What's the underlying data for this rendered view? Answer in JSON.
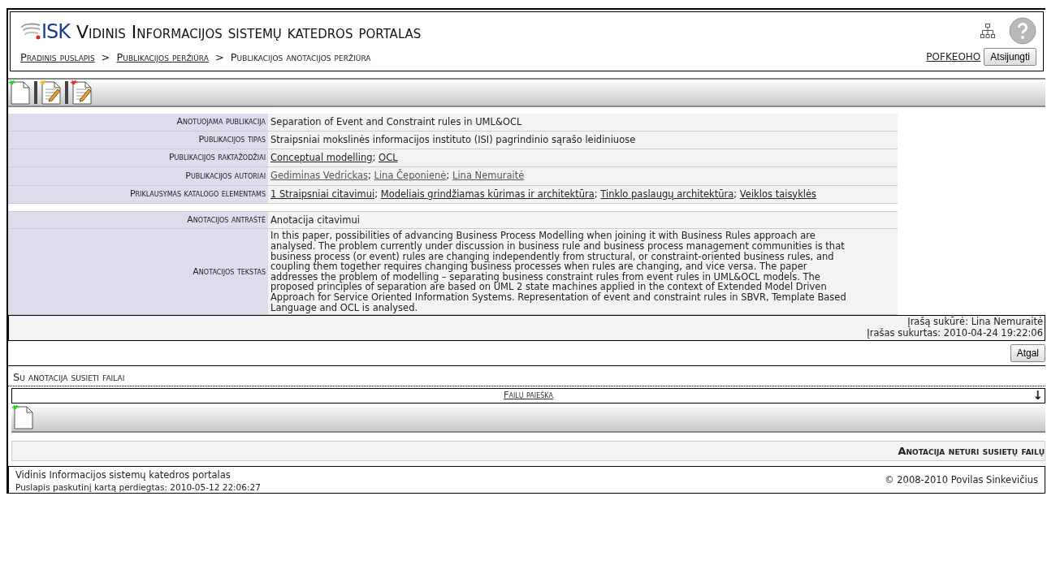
{
  "header": {
    "logo": "ISK",
    "title": "Vidinis Informacijos sistemų katedros portalas",
    "breadcrumbs": [
      {
        "text": "Pradinis puslapis",
        "link": true
      },
      {
        "text": "Publikacijos peržiūra",
        "link": true
      },
      {
        "text": "Publikacijos anotacijos peržiūra",
        "link": false
      }
    ],
    "separator": ">",
    "user": "POFKEOHO",
    "logout": "Atsijungti"
  },
  "toolbar": [
    {
      "kind": "new"
    },
    {
      "kind": "edit"
    },
    {
      "kind": "delete"
    }
  ],
  "publication": [
    {
      "label": "Anotuojama publikacija",
      "kind": "text",
      "value": "Separation of Event and Constraint rules in UML&OCL"
    },
    {
      "label": "Publikacijos tipas",
      "kind": "text",
      "value": "Straipsniai mokslinės informacijos instituto (ISI) pagrindinio sąrašo leidiniuose"
    },
    {
      "label": "Publikacijos raktažodžiai",
      "kind": "links",
      "separator": ";",
      "links": [
        {
          "text": "Conceptual modelling",
          "visited": false
        },
        {
          "text": "OCL",
          "visited": false
        }
      ]
    },
    {
      "label": "Publikacijos autoriai",
      "kind": "links",
      "separator": ";",
      "links": [
        {
          "text": "Gediminas Vedrickas",
          "visited": true
        },
        {
          "text": "Lina Čeponienė",
          "visited": true
        },
        {
          "text": "Lina Nemuraitė",
          "visited": true
        }
      ]
    },
    {
      "label": "Priklausymas katalogo elementams",
      "kind": "links",
      "separator": ";",
      "links": [
        {
          "text": "1 Straipsniai citavimui",
          "visited": false
        },
        {
          "text": "Modeliais grindžiamas kūrimas ir architektūra",
          "visited": false
        },
        {
          "text": "Tinklo paslaugų architektūra",
          "visited": false
        },
        {
          "text": "Veiklos taisyklės",
          "visited": false
        }
      ]
    }
  ],
  "annotation": [
    {
      "label": "Anotacijos antraštė",
      "value": "Anotacija citavimui"
    },
    {
      "label": "Anotacijos tekstas",
      "value": "In this paper, possibilities of advancing Business Process Modelling when joining it with Business Rules approach are analysed. The problem currently under discussion in business rule and business process management communities is that business process (or event) rules are changing independently from structural, or constraint-oriented business rules, and coupling them together requires changing business processes when rules are changing, and vice versa. The paper addresses the problem of modelling – separating business constraint rules from event rules in UML&OCL models. The proposed principles of separation are based on UML 2 state machines applied in the context of Extended Model Driven Approach for Service Oriented Information Systems. Representation of event and constraint rules in SBVR, Template Based Language and OCL is analysed."
    }
  ],
  "record": [
    {
      "label": "Įrašą sukūrė:",
      "value": "Lina Nemuraitė"
    },
    {
      "label": "Įrašas sukurtas:",
      "value": "2010-04-24 19:22:06"
    }
  ],
  "back_button": "Atgal",
  "files": {
    "title": "Su anotacija susieti failai",
    "search_link": "Failų paieška",
    "search_toggle": "↓",
    "toolbar": [
      {
        "kind": "new"
      }
    ],
    "empty_message": "Anotacija neturi susietų failų"
  },
  "footer": {
    "site": "Vidinis Informacijos sistemų katedros portalas",
    "updated": "Puslapis paskutinį kartą perdiegtas: 2010-05-12 22:06:27",
    "copyright": "© 2008-2010 Povilas Sinkevičius"
  }
}
